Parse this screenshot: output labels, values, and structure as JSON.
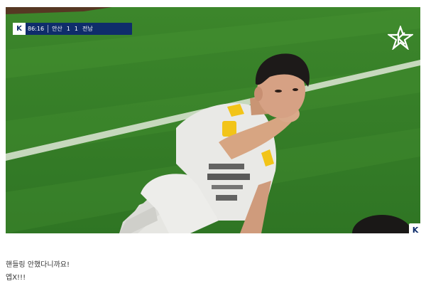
{
  "scoreboard": {
    "logo": "K",
    "time": "86:16",
    "home_team": "안산",
    "home_score": "1",
    "away_score": "1",
    "away_team": "전남"
  },
  "brand_logo_icon": "k-league-star-icon",
  "corner_badge": "K",
  "caption": {
    "line1": "핸들링 안했다니까요!",
    "line2": "엡X!!!"
  },
  "colors": {
    "pitch": "#3f8a2c",
    "scorebar": "#0f2d6b",
    "jersey": "#e8e8e4",
    "accent_yellow": "#f2c418"
  }
}
